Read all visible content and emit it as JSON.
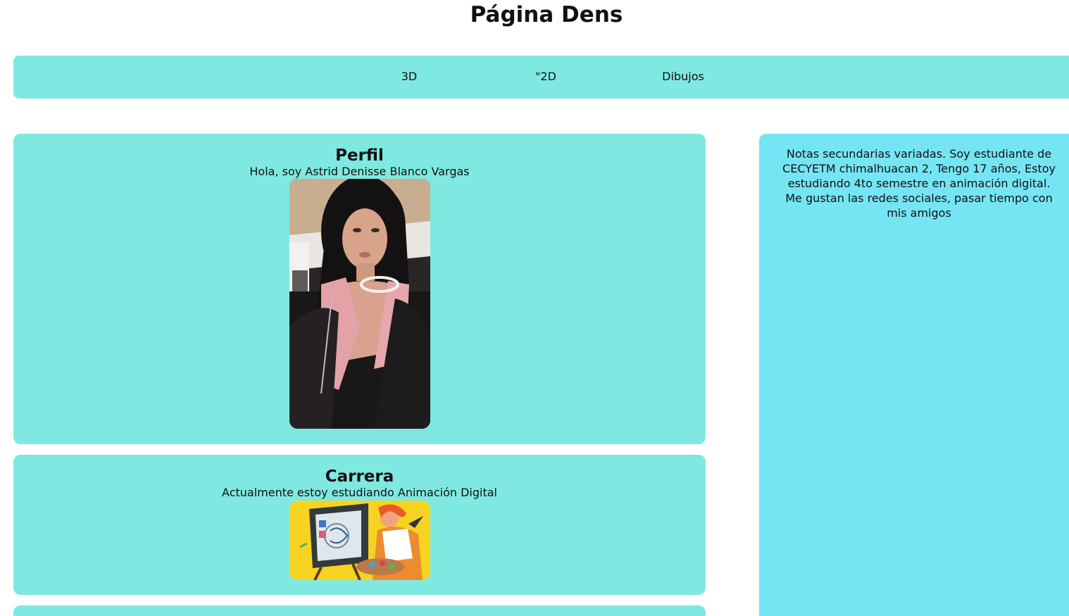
{
  "header": {
    "title": "Página Dens"
  },
  "nav": {
    "items": [
      {
        "label": "3D"
      },
      {
        "label": "\"2D"
      },
      {
        "label": "Dibujos"
      }
    ]
  },
  "profile": {
    "title": "Perfil",
    "subtitle": "Hola, soy Astrid Denisse Blanco Vargas"
  },
  "career": {
    "title": "Carrera",
    "subtitle": "Actualmente estoy estudiando Animación Digital"
  },
  "sidebar": {
    "notes": "Notas secundarias variadas. Soy estudiante de CECYETM chimalhuacan 2, Tengo 17 años, Estoy estudiando 4to semestre en animación digital. Me gustan las redes sociales, pasar tiempo con mis amigos"
  },
  "colors": {
    "nav_bg": "#7fe9e1",
    "card_bg": "#7fe9e1",
    "sidebar_bg": "#75e5f4"
  }
}
